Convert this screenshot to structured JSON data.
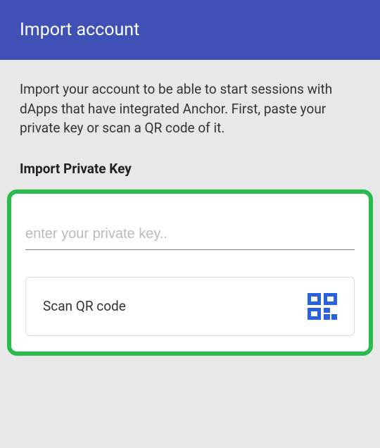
{
  "header": {
    "title": "Import account"
  },
  "main": {
    "description": "Import your account to be able to start sessions with dApps that have integrated Anchor. First, paste your private key or scan a QR code of it.",
    "section_title": "Import Private Key",
    "input_placeholder": "enter your private key..",
    "scan_button_label": "Scan QR code"
  }
}
